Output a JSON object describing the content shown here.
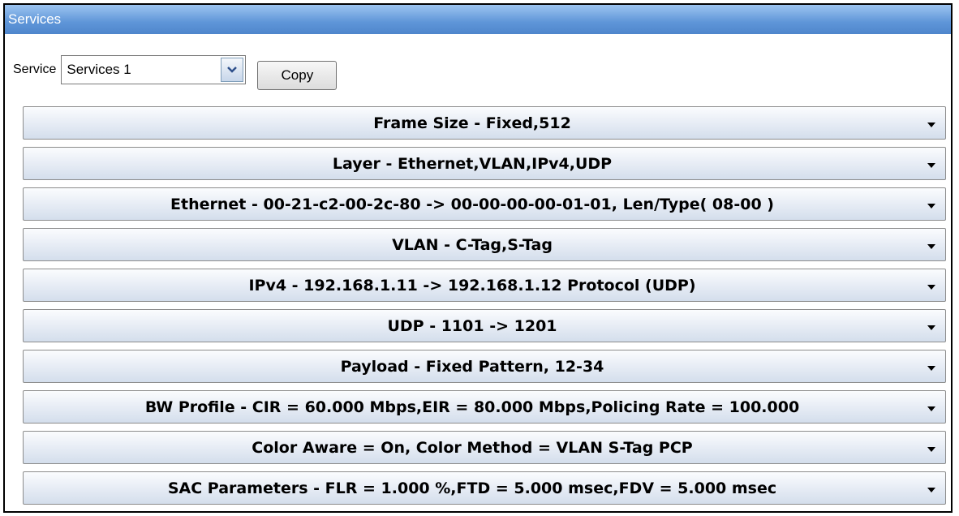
{
  "window": {
    "title": "Services"
  },
  "service": {
    "label": "Service",
    "selected": "Services 1",
    "copy_label": "Copy"
  },
  "rows": [
    {
      "label": "Frame Size - Fixed,512"
    },
    {
      "label": "Layer - Ethernet,VLAN,IPv4,UDP"
    },
    {
      "label": "Ethernet - 00-21-c2-00-2c-80 -> 00-00-00-00-01-01, Len/Type( 08-00 )"
    },
    {
      "label": "VLAN - C-Tag,S-Tag"
    },
    {
      "label": "IPv4 - 192.168.1.11 -> 192.168.1.12 Protocol (UDP)"
    },
    {
      "label": "UDP - 1101 -> 1201"
    },
    {
      "label": "Payload - Fixed Pattern, 12-34"
    },
    {
      "label": "BW Profile - CIR = 60.000 Mbps,EIR = 80.000 Mbps,Policing Rate = 100.000"
    },
    {
      "label": "Color Aware = On, Color Method = VLAN S-Tag PCP"
    },
    {
      "label": "SAC Parameters - FLR = 1.000 %,FTD = 5.000 msec,FDV = 5.000 msec"
    }
  ],
  "icons": {
    "select_arrow": "chevron-down-icon",
    "row_arrow": "dropdown-arrow-icon"
  }
}
